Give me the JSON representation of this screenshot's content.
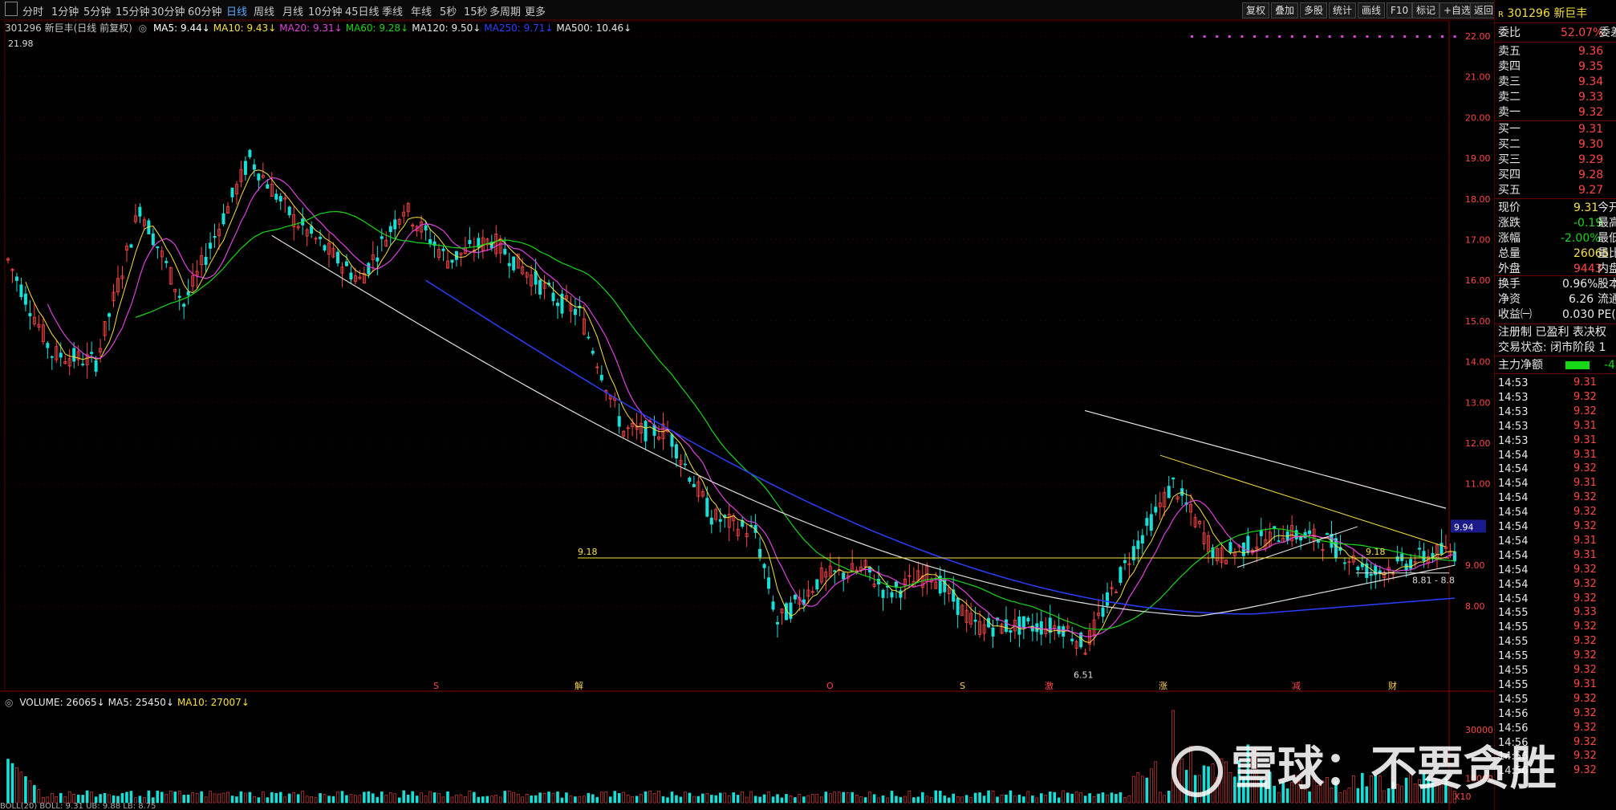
{
  "toolbar": {
    "periods": [
      "分时",
      "1分钟",
      "5分钟",
      "15分钟",
      "30分钟",
      "60分钟",
      "日线",
      "周线",
      "月线",
      "10分钟",
      "45日线",
      "季线",
      "年线",
      "5秒",
      "15秒",
      "多周期",
      "更多"
    ],
    "active_period": "日线",
    "right_buttons": [
      "复权",
      "叠加",
      "多股",
      "统计",
      "画线",
      "F10",
      "标记",
      "+自选",
      "返回"
    ]
  },
  "indicator_line": {
    "stock": "301296 新巨丰(日线 前复权)",
    "items": [
      {
        "label": "MA5: 9.44",
        "color": "#ffffff"
      },
      {
        "label": "MA10: 9.43",
        "color": "#f6e03b"
      },
      {
        "label": "MA20: 9.31",
        "color": "#e040e0"
      },
      {
        "label": "MA60: 9.28",
        "color": "#16d816"
      },
      {
        "label": "MA120: 9.50",
        "color": "#e8e8e8"
      },
      {
        "label": "MA250: 9.71",
        "color": "#2a3fff"
      },
      {
        "label": "MA500: 10.46",
        "color": "#e8e8e8"
      }
    ]
  },
  "chart_labels": {
    "max_marker": "21.98",
    "min_marker": "6.51",
    "support_left": "9.18",
    "support_right": "9.18",
    "range_label": "8.81 - 8.8",
    "current_price_tag": "9.94"
  },
  "price_axis": [
    "22.00",
    "21.00",
    "20.00",
    "19.00",
    "18.00",
    "17.00",
    "16.00",
    "15.00",
    "14.00",
    "13.00",
    "12.00",
    "11.00",
    "9.00",
    "8.00"
  ],
  "event_markers": [
    "S",
    "解",
    "O",
    "S",
    "激",
    "涨",
    "减",
    "财"
  ],
  "volume": {
    "header": [
      {
        "label": "VOLUME: 26065",
        "color": "#e8e8e8"
      },
      {
        "label": "MA5: 25450",
        "color": "#e8e8e8"
      },
      {
        "label": "MA10: 27007",
        "color": "#f6e03b"
      }
    ],
    "axis": [
      "30000",
      "10000"
    ],
    "unit": "X10",
    "bottom_text": "BOLL(20)  BOLL: 9.31  UB: 9.88  LB: 8.75"
  },
  "quote_panel": {
    "code": "301296",
    "name": "新巨丰",
    "weibi_label": "委比",
    "weibi_value": "52.07%",
    "weicha_label": "委差",
    "sells": [
      {
        "label": "卖五",
        "price": "9.36"
      },
      {
        "label": "卖四",
        "price": "9.35"
      },
      {
        "label": "卖三",
        "price": "9.34"
      },
      {
        "label": "卖二",
        "price": "9.33"
      },
      {
        "label": "卖一",
        "price": "9.32"
      }
    ],
    "buys": [
      {
        "label": "买一",
        "price": "9.31"
      },
      {
        "label": "买二",
        "price": "9.30"
      },
      {
        "label": "买三",
        "price": "9.29"
      },
      {
        "label": "买四",
        "price": "9.28"
      },
      {
        "label": "买五",
        "price": "9.27"
      }
    ],
    "stats": [
      {
        "label": "现价",
        "value": "9.31",
        "color": "#f6e03b",
        "right": "今开"
      },
      {
        "label": "涨跌",
        "value": "-0.19",
        "color": "#16d816",
        "right": "最高"
      },
      {
        "label": "涨幅",
        "value": "-2.00%",
        "color": "#16d816",
        "right": "最低"
      },
      {
        "label": "总量",
        "value": "26065",
        "color": "#f6e03b",
        "right": "量比"
      },
      {
        "label": "外盘",
        "value": "9443",
        "color": "#ff4545",
        "right": "内盘"
      }
    ],
    "stats2": [
      {
        "label": "换手",
        "value": "0.96%",
        "right": "股本"
      },
      {
        "label": "净资",
        "value": "6.26",
        "right": "流通"
      },
      {
        "label": "收益㈠",
        "value": "0.030",
        "right": "PE(动"
      }
    ],
    "reg_line": "注册制 已盈利 表决权",
    "trade_status": "交易状态: 闭市阶段 1",
    "mainforce_label": "主力净额",
    "mainforce_value": "-4",
    "ticks": [
      {
        "t": "14:53",
        "p": "9.31"
      },
      {
        "t": "14:53",
        "p": "9.32"
      },
      {
        "t": "14:53",
        "p": "9.32"
      },
      {
        "t": "14:53",
        "p": "9.31"
      },
      {
        "t": "14:53",
        "p": "9.31"
      },
      {
        "t": "14:54",
        "p": "9.31"
      },
      {
        "t": "14:54",
        "p": "9.32"
      },
      {
        "t": "14:54",
        "p": "9.31"
      },
      {
        "t": "14:54",
        "p": "9.32"
      },
      {
        "t": "14:54",
        "p": "9.32"
      },
      {
        "t": "14:54",
        "p": "9.32"
      },
      {
        "t": "14:54",
        "p": "9.31"
      },
      {
        "t": "14:54",
        "p": "9.31"
      },
      {
        "t": "14:54",
        "p": "9.32"
      },
      {
        "t": "14:54",
        "p": "9.32"
      },
      {
        "t": "14:54",
        "p": "9.32"
      },
      {
        "t": "14:55",
        "p": "9.33"
      },
      {
        "t": "14:55",
        "p": "9.32"
      },
      {
        "t": "14:55",
        "p": "9.32"
      },
      {
        "t": "14:55",
        "p": "9.32"
      },
      {
        "t": "14:55",
        "p": "9.32"
      },
      {
        "t": "14:55",
        "p": "9.31"
      },
      {
        "t": "14:55",
        "p": "9.32"
      },
      {
        "t": "14:56",
        "p": "9.32"
      },
      {
        "t": "14:56",
        "p": "9.32"
      },
      {
        "t": "14:56",
        "p": "9.32"
      },
      {
        "t": "14:56",
        "p": "9.32"
      },
      {
        "t": "14:56",
        "p": "9.32"
      }
    ]
  },
  "watermark": "雪球：不要贪胜",
  "colors": {
    "up": "#ff4545",
    "down": "#17e0d8",
    "ma5": "#ffffff",
    "ma10": "#f6e03b",
    "ma20": "#e040e0",
    "ma60": "#16d816",
    "ma250": "#2a3fff",
    "ma500": "#dddddd"
  }
}
